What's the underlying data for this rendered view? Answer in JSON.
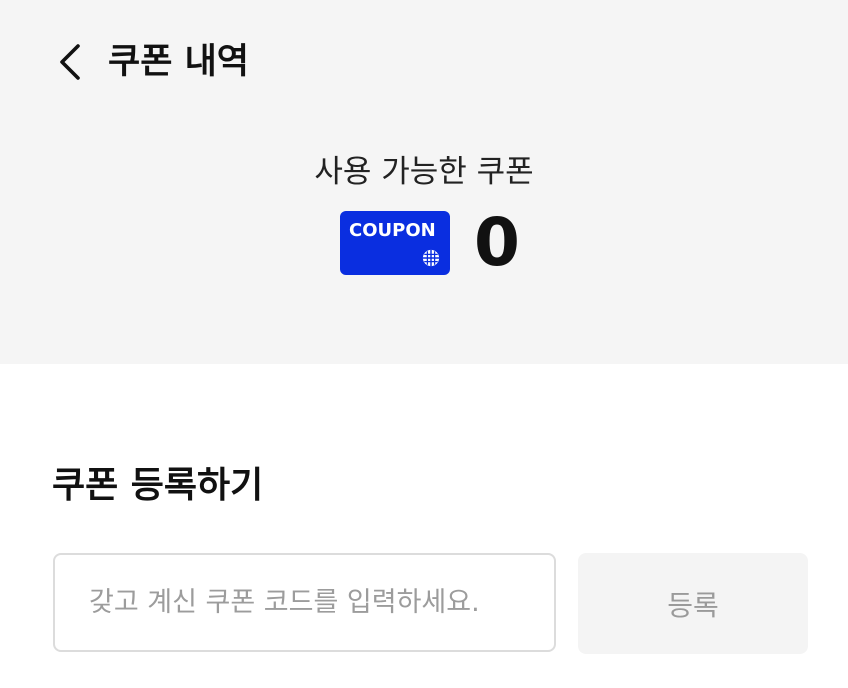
{
  "header": {
    "title": "쿠폰 내역",
    "back_icon": "chevron-left-icon"
  },
  "summary": {
    "label": "사용 가능한 쿠폰",
    "badge_text": "COUPON",
    "badge_color": "#0a2ee0",
    "badge_icon": "globe-icon",
    "count": "0"
  },
  "register": {
    "title": "쿠폰 등록하기",
    "input_placeholder": "갖고 계신 쿠폰 코드를 입력하세요.",
    "input_value": "",
    "button_label": "등록"
  },
  "colors": {
    "top_background": "#f5f5f5",
    "page_background": "#ffffff"
  }
}
